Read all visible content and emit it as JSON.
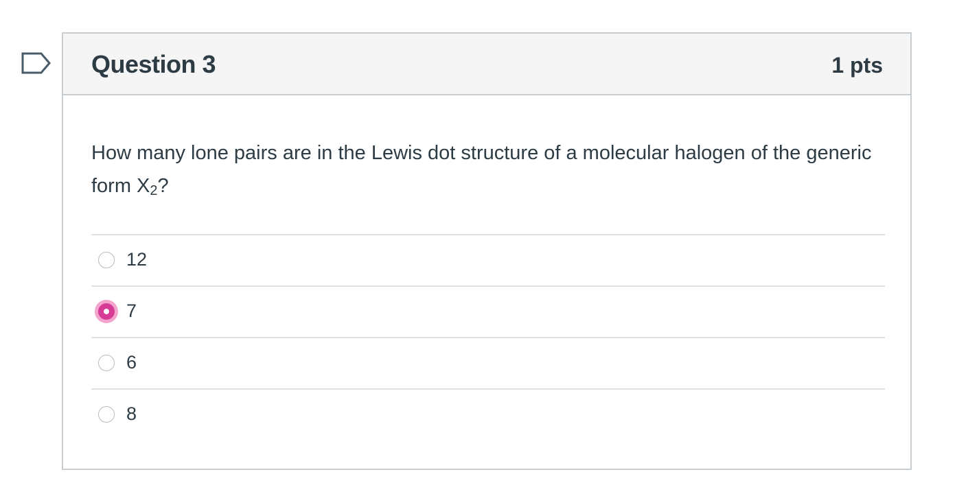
{
  "question": {
    "title": "Question 3",
    "points": "1 pts",
    "text_before": "How many lone pairs are in the Lewis dot structure of a molecular halogen of the generic form X",
    "text_subscript": "2",
    "text_after": "?"
  },
  "flag": {
    "icon": "flag-question-icon"
  },
  "answers": [
    {
      "label": "12",
      "selected": false
    },
    {
      "label": "7",
      "selected": true
    },
    {
      "label": "6",
      "selected": false
    },
    {
      "label": "8",
      "selected": false
    }
  ],
  "colors": {
    "selected_radio": "#d63b95",
    "selected_ring": "#f3a5cd",
    "border": "#c7cdd1",
    "header_bg": "#f5f5f5",
    "text": "#2d3b45"
  }
}
